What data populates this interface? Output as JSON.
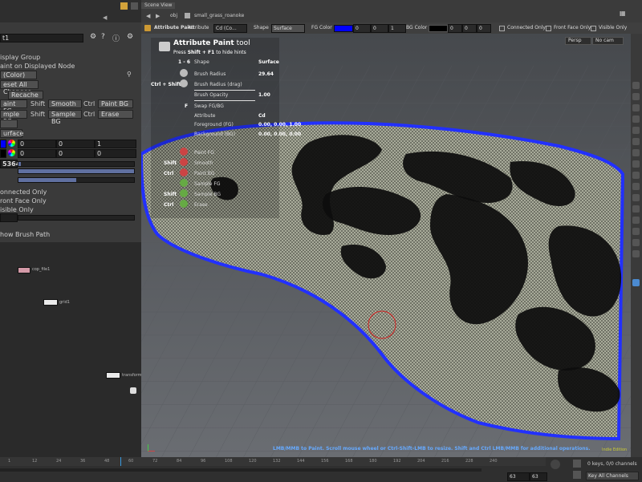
{
  "header": {
    "tab_scene": "Scene View",
    "path_obj": "obj",
    "path_node": "small_grass_roanoke"
  },
  "toolbar": {
    "tool_name": "Attribute Paint",
    "attribute_label": "Attribute",
    "attribute_value": "Cd (Co...",
    "shape_label": "Shape",
    "shape_value": "Surface",
    "fg_label": "FG Color",
    "fg_color": "#0000ff",
    "fg_v1": "0",
    "fg_v2": "0",
    "fg_v3": "1",
    "bg_label": "BG Color",
    "bg_color": "#000000",
    "bg_v1": "0",
    "bg_v2": "0",
    "bg_v3": "0",
    "connected_only": "Connected Only",
    "front_face_only": "Front Face Only",
    "visible_only": "Visible Only"
  },
  "viewport": {
    "persp": "Persp",
    "cam": "No cam",
    "status_bar": "LMB/MMB to Paint.  Scroll mouse wheel or Ctrl-Shift-LMB to resize.  Shift and Ctrl LMB/MMB for additional operations.",
    "corner_label": "Indie Edition"
  },
  "hints": {
    "title": "Attribute Paint",
    "title_suffix": " tool",
    "subtitle_pre": "Press ",
    "subtitle_key": "Shift + F1",
    "subtitle_post": " to hide hints",
    "key_1_6": "1 - 6",
    "shape_label": "Shape",
    "shape_value": "Surface",
    "brush_radius_label": "Brush Radius",
    "brush_radius_value": "29.64",
    "ctrl_shift": "Ctrl + Shift +",
    "brush_radius_drag_label": "Brush Radius (drag)",
    "brush_opacity_label": "Brush Opacity",
    "brush_opacity_value": "1.00",
    "key_f": "F",
    "swap_label": "Swap FG/BG",
    "attribute_label": "Attribute",
    "attribute_value": "Cd",
    "foreground_label": "Foreground (FG)",
    "foreground_value": "0.00, 0.00, 1.00",
    "background_label": "Background (BG)",
    "background_value": "0.00, 0.00, 0.00",
    "mouse_hints": [
      {
        "key": "",
        "label": "Paint FG"
      },
      {
        "key": "Shift",
        "label": "Smooth"
      },
      {
        "key": "Ctrl",
        "label": "Paint BG"
      },
      {
        "key": "",
        "label": "Sample FG"
      },
      {
        "key": "Shift",
        "label": "Sample BG"
      },
      {
        "key": "Ctrl",
        "label": "Erase"
      }
    ]
  },
  "left_panel": {
    "search_value": "t1",
    "display_group": "isplay Group",
    "paint_on_displayed": "aint on Displayed Node",
    "color_value": "(Color)",
    "reset_all_changes": "eset All Changes",
    "recache": "Recache",
    "lmb_paint_fg": "aint FG",
    "shift_1": "Shift",
    "smooth": "Smooth",
    "ctrl_1": "Ctrl",
    "paint_bg": "Paint BG",
    "mmb_sample_fg": "mple FG",
    "shift_2": "Shift",
    "sample_bg": "Sample BG",
    "ctrl_2": "Ctrl",
    "erase": "Erase",
    "fg_blank": "",
    "surface": "urface",
    "fg_values": [
      "0",
      "0",
      "1"
    ],
    "bg_values": [
      "0",
      "0",
      "0"
    ],
    "radius_value": "5364",
    "connected_only": "onnected Only",
    "front_face_only": "ront Face Only",
    "visible_only": "isible Only",
    "show_brush_path": "how Brush Path"
  },
  "network": {
    "node1": "cop_file1",
    "node2": "grid1",
    "node3": "transform1"
  },
  "timeline": {
    "ticks": [
      "1",
      "12",
      "24",
      "36",
      "48",
      "60",
      "72",
      "84",
      "96",
      "108",
      "120",
      "132",
      "144",
      "156",
      "168",
      "180",
      "192",
      "204",
      "216",
      "228",
      "240"
    ],
    "current_frame": "63",
    "end_frame": "63",
    "keys_info": "0 keys, 0/0 channels",
    "key_all_channels": "Key All Channels"
  }
}
